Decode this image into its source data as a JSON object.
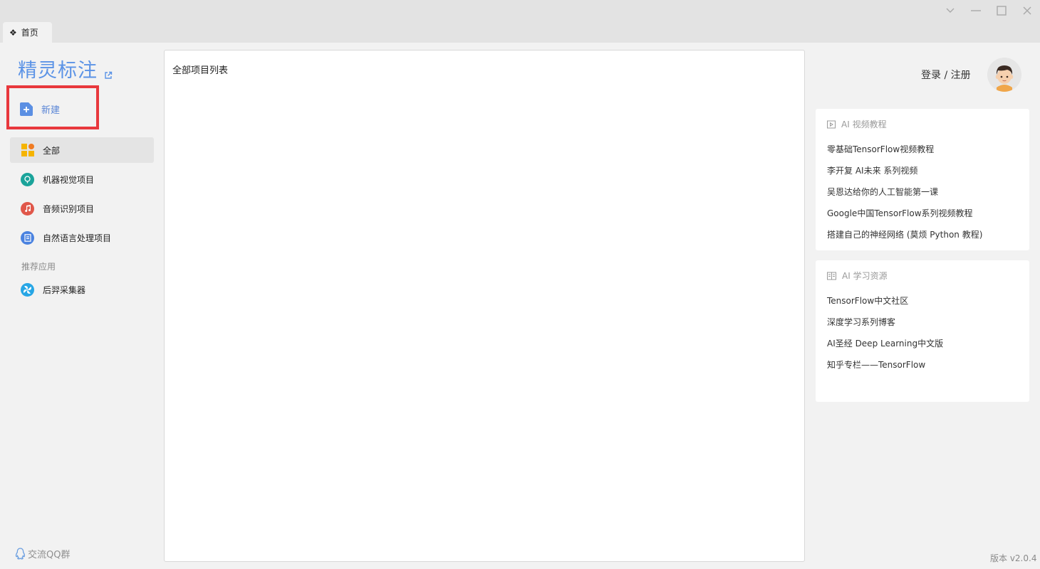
{
  "window": {
    "tab_label": "首页",
    "tab_icon": "diamond-grid-icon",
    "controls": [
      "chevron-down-icon",
      "minimize-icon",
      "maximize-icon",
      "close-icon"
    ]
  },
  "sidebar": {
    "brand": "精灵标注",
    "new_label": "新建",
    "items": [
      {
        "label": "全部",
        "icon": "grid-icon",
        "active": true
      },
      {
        "label": "机器视觉项目",
        "icon": "vision-icon"
      },
      {
        "label": "音频识别项目",
        "icon": "music-icon"
      },
      {
        "label": "自然语言处理项目",
        "icon": "document-icon"
      }
    ],
    "recommend_label": "推荐应用",
    "recommend_items": [
      {
        "label": "后羿采集器",
        "icon": "collector-icon"
      }
    ],
    "qq_label": "交流QQ群"
  },
  "main": {
    "title": "全部项目列表"
  },
  "right": {
    "login_label": "登录 / 注册",
    "video_card": {
      "title": "AI 视频教程",
      "links": [
        "零基础TensorFlow视频教程",
        "李开复 AI未来 系列视频",
        "吴恩达给你的人工智能第一课",
        "Google中国TensorFlow系列视频教程",
        "搭建自己的神经网络 (莫烦 Python 教程)"
      ]
    },
    "resource_card": {
      "title": "AI 学习资源",
      "links": [
        "TensorFlow中文社区",
        "深度学习系列博客",
        "AI圣经 Deep Learning中文版",
        "知乎专栏——TensorFlow"
      ]
    },
    "version": "版本 v2.0.4"
  },
  "colors": {
    "brand": "#5b93e6",
    "highlight": "#e8383d",
    "vision": "#1aa39a",
    "audio": "#e0574a",
    "nlp": "#4a82e0",
    "collector": "#27a6e5"
  }
}
